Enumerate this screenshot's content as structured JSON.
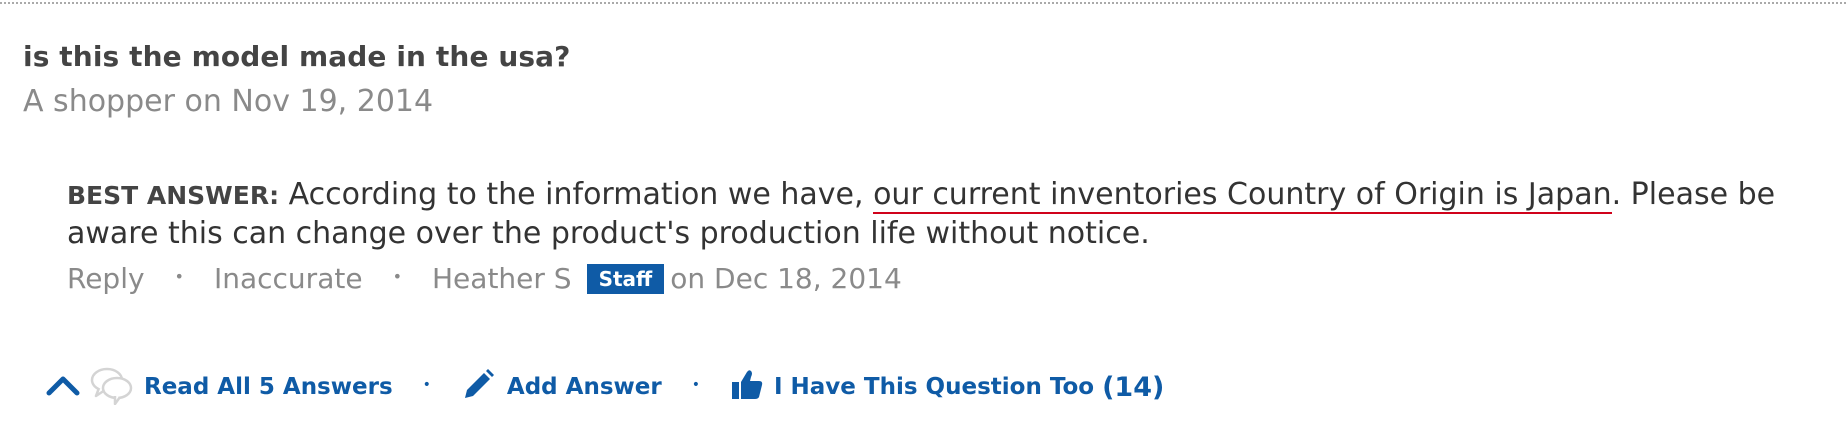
{
  "question": {
    "text": "is this the model made in the usa?",
    "asker": "A shopper",
    "on_label": "on",
    "date": "Nov 19, 2014"
  },
  "answer": {
    "label": "BEST ANSWER:",
    "text_before": "According to the information we have,",
    "text_highlight": "our current inventories Country of Origin is Japan",
    "text_after": ". Please be aware this can change over the product's production life without notice.",
    "highlight_color": "#d0021b"
  },
  "meta": {
    "reply": "Reply",
    "inaccurate": "Inaccurate",
    "separator": "•",
    "author": "Heather S",
    "badge": "Staff",
    "date_text": "on Dec 18, 2014",
    "badge_color": "#0f5ba6"
  },
  "actions": {
    "collapse_icon": "chevron-up-icon",
    "answers_icon": "speech-bubbles-icon",
    "read_all": "Read All 5 Answers",
    "add_icon": "pencil-icon",
    "add_answer": "Add Answer",
    "thumb_icon": "thumbs-up-icon",
    "question_too": "I Have This Question Too",
    "count": "(14)",
    "separator": "•",
    "link_color": "#0f5ba6"
  }
}
